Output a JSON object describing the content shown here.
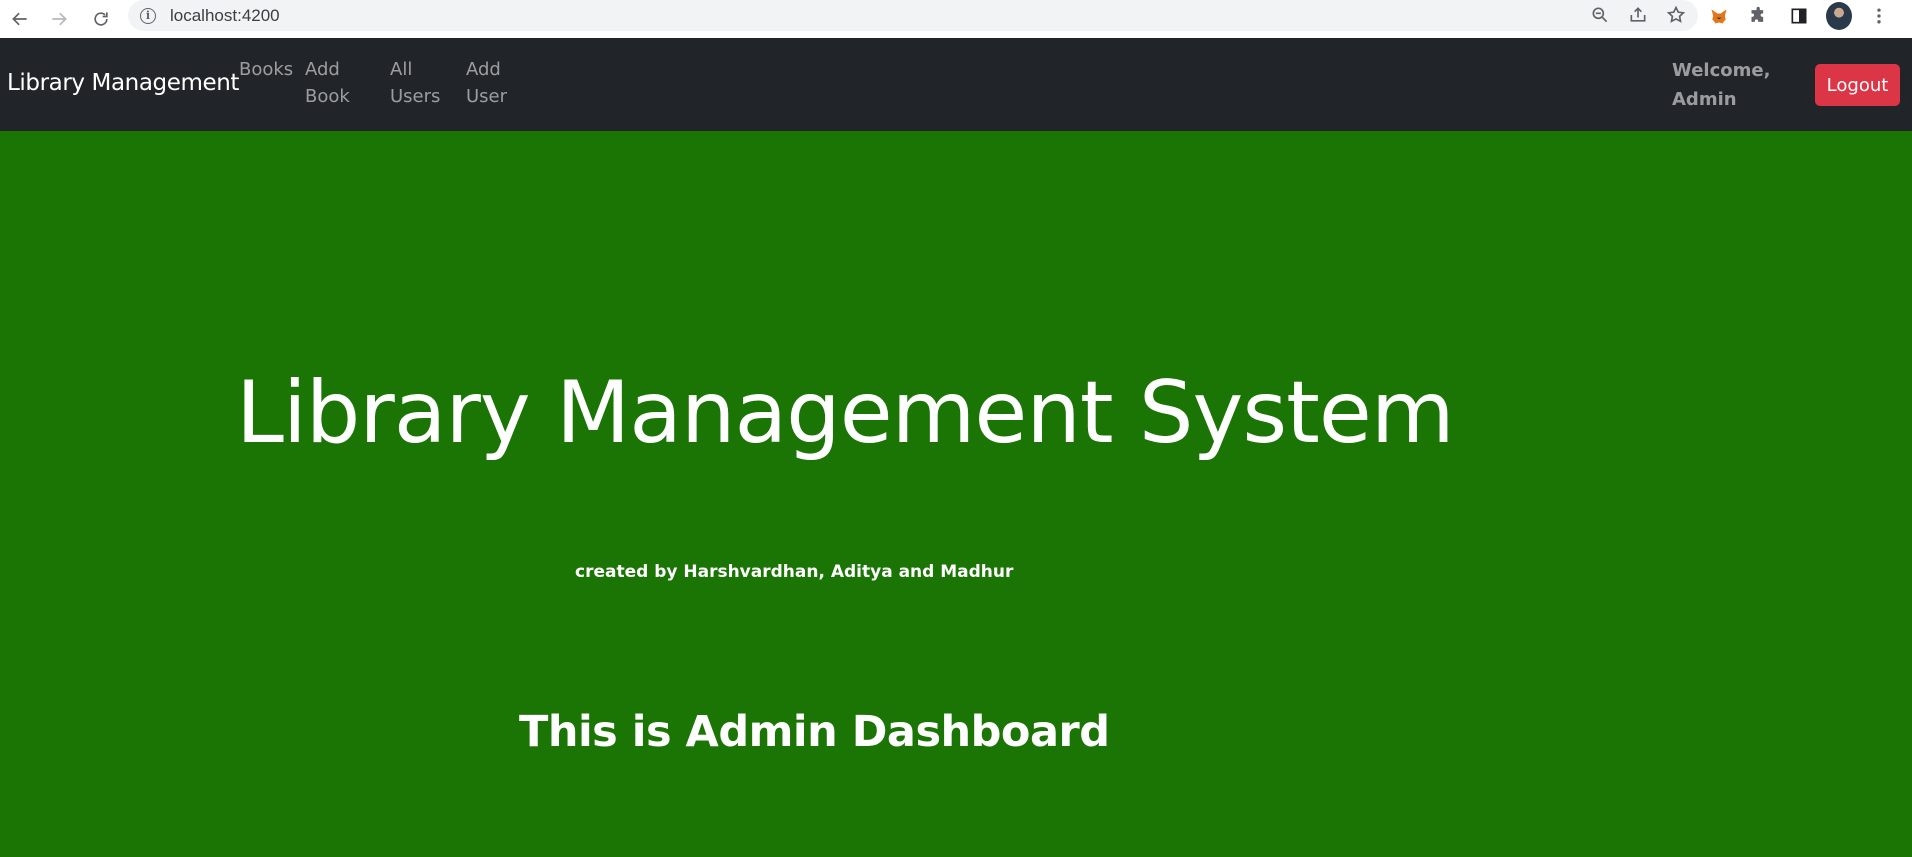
{
  "browser": {
    "url": "localhost:4200"
  },
  "navbar": {
    "brand": "Library Management",
    "links": [
      {
        "line1": "Books",
        "line2": ""
      },
      {
        "line1": "Add",
        "line2": "Book"
      },
      {
        "line1": "All",
        "line2": "Users"
      },
      {
        "line1": "Add",
        "line2": "User"
      }
    ],
    "welcome_line1": "Welcome,",
    "welcome_line2": "Admin",
    "logout_label": "Logout"
  },
  "main": {
    "title": "Library Management System",
    "credits": "created by Harshvardhan, Aditya and Madhur",
    "dashboard_heading": "This is Admin Dashboard"
  },
  "colors": {
    "page_background": "#1a7504",
    "navbar_background": "#212529",
    "logout_button": "#dc3545"
  }
}
